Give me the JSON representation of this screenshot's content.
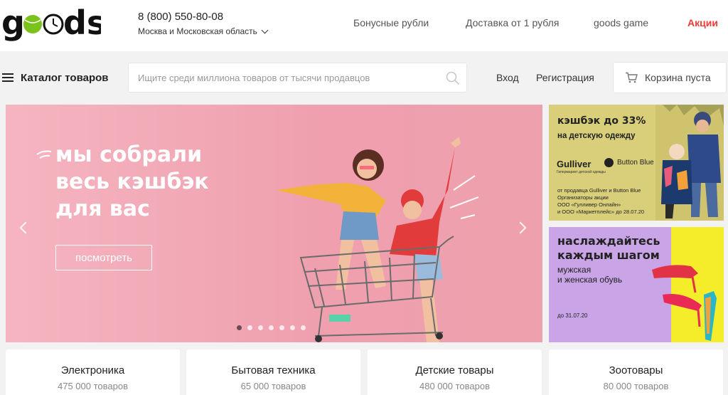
{
  "header": {
    "logo": "goods",
    "phone": "8 (800) 550-80-08",
    "region": "Москва и Московская область",
    "links": [
      "Бонусные рубли",
      "Доставка от 1 рубля",
      "goods game"
    ],
    "promo": "Акции",
    "promo_color": "#f23a3a"
  },
  "nav": {
    "catalog": "Каталог товаров",
    "search_placeholder": "Ищите среди миллиона товаров от тысячи продавцов",
    "login": "Вход",
    "register": "Регистрация",
    "cart": "Корзина пуста"
  },
  "hero": {
    "title_lines": [
      "мы собрали",
      "весь кэшбэк",
      "для вас"
    ],
    "button": "посмотреть",
    "slides_total": 7,
    "active_slide": 1
  },
  "side_banner_1": {
    "headline": "кэшбэк до 33%",
    "subline": "на детскую одежду",
    "brand_1": "Gulliver",
    "brand_1_sub": "Гипермаркет детской одежды",
    "brand_2": "Button Blue",
    "fine_print": [
      "от продавца Gulliver и Button Blue",
      "Организаторы акции",
      "ООО «Гулливер Онлайн»",
      "и ООО «Маркетплейс» до 28.07.20"
    ]
  },
  "side_banner_2": {
    "headline_lines": [
      "наслаждайтесь",
      "каждым шагом"
    ],
    "sub_lines": [
      "мужская",
      "и женская обувь"
    ],
    "date": "до 31.07.20"
  },
  "categories": [
    {
      "title": "Электроника",
      "count": "475 000 товаров"
    },
    {
      "title": "Бытовая техника",
      "count": "65 000 товаров"
    },
    {
      "title": "Детские товары",
      "count": "480 000 товаров"
    },
    {
      "title": "Зоотовары",
      "count": "80 000 товаров"
    }
  ]
}
